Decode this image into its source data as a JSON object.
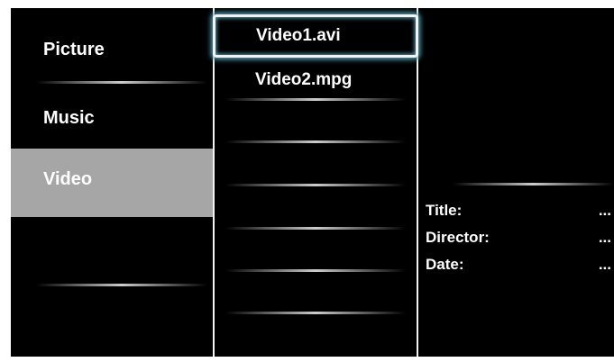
{
  "categories": [
    {
      "label": "Picture",
      "selected": false
    },
    {
      "label": "Music",
      "selected": false
    },
    {
      "label": "Video",
      "selected": true
    }
  ],
  "files": [
    {
      "label": "Video1.avi",
      "selected": true
    },
    {
      "label": "Video2.mpg",
      "selected": false
    }
  ],
  "details": [
    {
      "label": "Title:",
      "value": "..."
    },
    {
      "label": "Director:",
      "value": "..."
    },
    {
      "label": "Date:",
      "value": "..."
    }
  ],
  "colors": {
    "background": "#000000",
    "selected_category": "#a6a6a6",
    "focus_glow": "#59a3b8",
    "text": "#ffffff"
  }
}
